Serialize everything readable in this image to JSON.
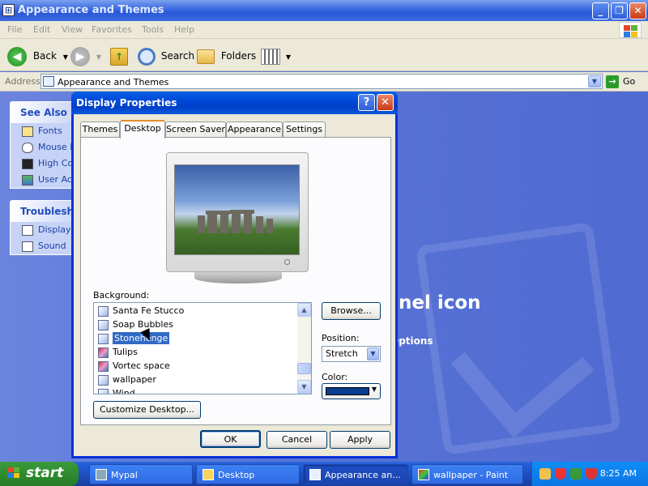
{
  "window": {
    "title": "Appearance and Themes",
    "min_btn": "_",
    "max_btn": "❐",
    "close_btn": "✕"
  },
  "menu": [
    "File",
    "Edit",
    "View",
    "Favorites",
    "Tools",
    "Help"
  ],
  "toolbar": {
    "back": "Back",
    "search": "Search",
    "folders": "Folders"
  },
  "address": {
    "label": "Address",
    "value": "Appearance and Themes",
    "go": "Go"
  },
  "see_also": {
    "header": "See Also",
    "items": [
      "Fonts",
      "Mouse P",
      "High Co",
      "User Acc"
    ]
  },
  "troubleshooters": {
    "header": "Troubleshoo",
    "items": [
      "Display",
      "Sound"
    ]
  },
  "background_text": {
    "heading": "nel icon",
    "options": "Options"
  },
  "dialog": {
    "title": "Display Properties",
    "help_btn": "?",
    "close_btn": "✕",
    "tabs": [
      "Themes",
      "Desktop",
      "Screen Saver",
      "Appearance",
      "Settings"
    ],
    "active_tab": "Desktop",
    "background_label": "Background:",
    "background_items": [
      "Santa Fe Stucco",
      "Soap Bubbles",
      "Stonehenge",
      "Tulips",
      "Vortec space",
      "wallpaper",
      "Wind"
    ],
    "selected_item": "Stonehenge",
    "browse_btn": "Browse...",
    "position_label": "Position:",
    "position_value": "Stretch",
    "color_label": "Color:",
    "color_value": "#0a3d8f",
    "customize_btn": "Customize Desktop...",
    "ok_btn": "OK",
    "cancel_btn": "Cancel",
    "apply_btn": "Apply"
  },
  "taskbar": {
    "start": "start",
    "tasks": [
      {
        "label": "Mypal",
        "active": false
      },
      {
        "label": "Desktop",
        "active": false
      },
      {
        "label": "Appearance an...",
        "active": true
      },
      {
        "label": "wallpaper - Paint",
        "active": false
      }
    ],
    "clock": "8:25 AM"
  }
}
